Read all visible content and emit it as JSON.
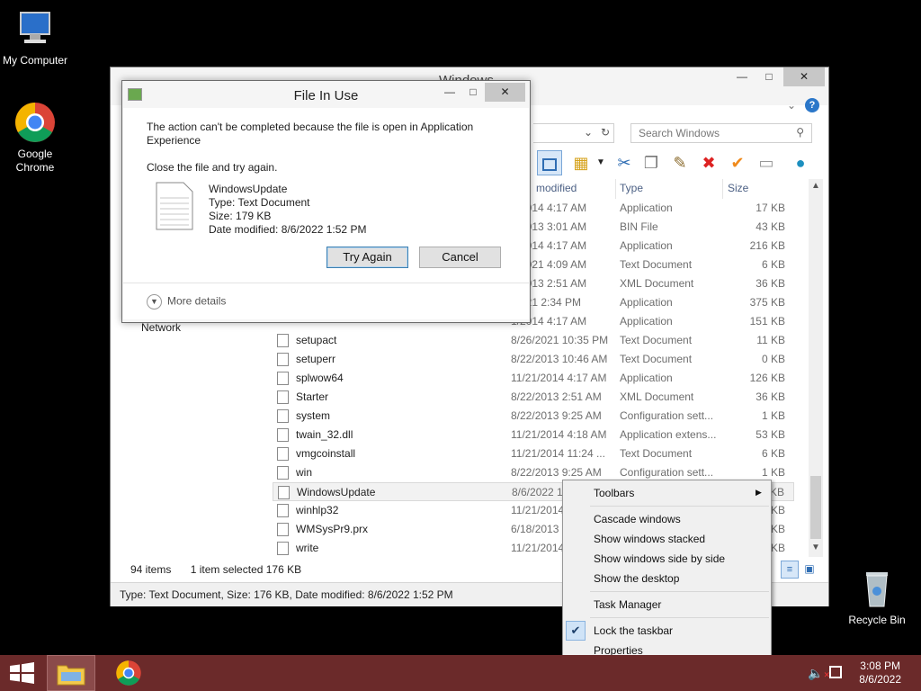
{
  "desktop": {
    "icons": [
      {
        "label": "My Computer"
      },
      {
        "label": "Google Chrome"
      },
      {
        "label": "Recycle Bin"
      }
    ]
  },
  "explorer": {
    "title": "Windows",
    "search_placeholder": "Search Windows",
    "columns": {
      "modified": "modified",
      "type": "Type",
      "size": "Size"
    },
    "nav_partial": "Network",
    "rows": [
      {
        "name": "",
        "date": "1/2014 4:17 AM",
        "type": "Application",
        "size": "17 KB"
      },
      {
        "name": "",
        "date": "2/2013 3:01 AM",
        "type": "BIN File",
        "size": "43 KB"
      },
      {
        "name": "",
        "date": "1/2014 4:17 AM",
        "type": "Application",
        "size": "216 KB"
      },
      {
        "name": "",
        "date": "5/2021 4:09 AM",
        "type": "Text Document",
        "size": "6 KB"
      },
      {
        "name": "",
        "date": "2/2013 2:51 AM",
        "type": "XML Document",
        "size": "36 KB"
      },
      {
        "name": "",
        "date": "/2021 2:34 PM",
        "type": "Application",
        "size": "375 KB"
      },
      {
        "name": "",
        "date": "1/2014 4:17 AM",
        "type": "Application",
        "size": "151 KB"
      },
      {
        "name": "setupact",
        "date": "8/26/2021 10:35 PM",
        "type": "Text Document",
        "size": "11 KB"
      },
      {
        "name": "setuperr",
        "date": "8/22/2013 10:46 AM",
        "type": "Text Document",
        "size": "0 KB"
      },
      {
        "name": "splwow64",
        "date": "11/21/2014 4:17 AM",
        "type": "Application",
        "size": "126 KB"
      },
      {
        "name": "Starter",
        "date": "8/22/2013 2:51 AM",
        "type": "XML Document",
        "size": "36 KB"
      },
      {
        "name": "system",
        "date": "8/22/2013 9:25 AM",
        "type": "Configuration sett...",
        "size": "1 KB"
      },
      {
        "name": "twain_32.dll",
        "date": "11/21/2014 4:18 AM",
        "type": "Application extens...",
        "size": "53 KB"
      },
      {
        "name": "vmgcoinstall",
        "date": "11/21/2014 11:24 ...",
        "type": "Text Document",
        "size": "6 KB"
      },
      {
        "name": "win",
        "date": "8/22/2013 9:25 AM",
        "type": "Configuration sett...",
        "size": "1 KB"
      },
      {
        "name": "WindowsUpdate",
        "date": "8/6/2022 1:",
        "type": "",
        "size": "KB"
      },
      {
        "name": "winhlp32",
        "date": "11/21/2014",
        "type": "",
        "size": "KB"
      },
      {
        "name": "WMSysPr9.prx",
        "date": "6/18/2013",
        "type": "",
        "size": "KB"
      },
      {
        "name": "write",
        "date": "11/21/2014",
        "type": "",
        "size": "KB"
      }
    ],
    "status_items": "94 items",
    "status_selected": "1 item selected  176 KB",
    "details_bar": "Type: Text Document, Size: 176 KB, Date modified: 8/6/2022 1:52 PM"
  },
  "dialog": {
    "title": "File In Use",
    "message": "The action can't be completed because the file is open in Application Experience",
    "instruction": "Close the file and try again.",
    "file_name": "WindowsUpdate",
    "file_type": "Type: Text Document",
    "file_size": "Size: 179 KB",
    "file_date": "Date modified: 8/6/2022 1:52 PM",
    "try_again": "Try Again",
    "cancel": "Cancel",
    "more_details": "More details"
  },
  "context_menu": {
    "toolbars": "Toolbars",
    "cascade": "Cascade windows",
    "stacked": "Show windows stacked",
    "side_by_side": "Show windows side by side",
    "show_desktop": "Show the desktop",
    "task_manager": "Task Manager",
    "lock_taskbar": "Lock the taskbar",
    "properties": "Properties"
  },
  "taskbar": {
    "time": "3:08 PM",
    "date": "8/6/2022",
    "color": "#6b2a2a"
  }
}
